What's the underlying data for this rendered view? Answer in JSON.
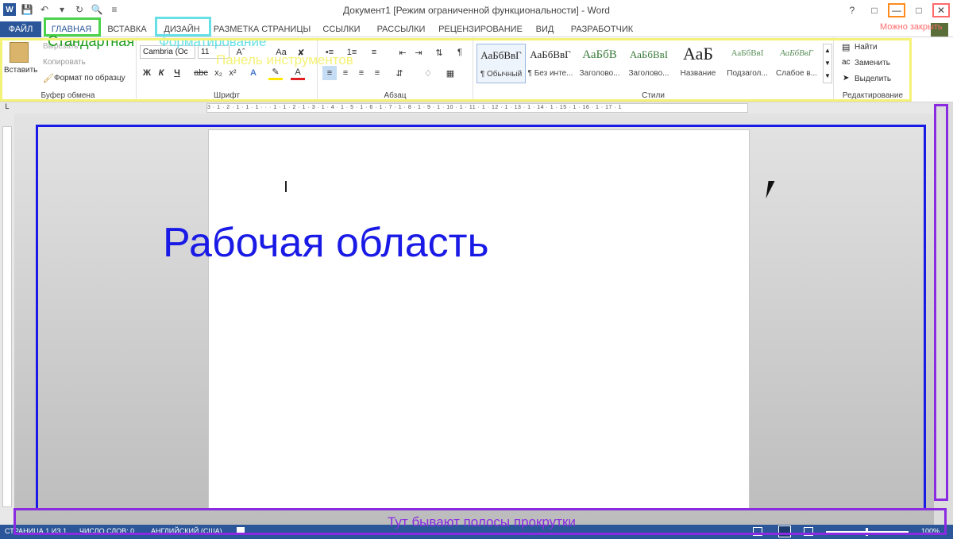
{
  "window": {
    "title": "Документ1 [Режим ограниченной функциональности] - Word",
    "word_icon": "W"
  },
  "tabs": [
    {
      "label": "ФАЙЛ"
    },
    {
      "label": "ГЛАВНАЯ"
    },
    {
      "label": "ВСТАВКА"
    },
    {
      "label": "ДИЗАЙН"
    },
    {
      "label": "РАЗМЕТКА СТРАНИЦЫ"
    },
    {
      "label": "ССЫЛКИ"
    },
    {
      "label": "РАССЫЛКИ"
    },
    {
      "label": "РЕЦЕНЗИРОВАНИЕ"
    },
    {
      "label": "ВИД"
    },
    {
      "label": "РАЗРАБОТЧИК"
    }
  ],
  "clipboard": {
    "paste": "Вставить",
    "cut": "Вырезать",
    "copy": "Копировать",
    "format_painter": "Формат по образцу",
    "group_label": "Буфер обмена"
  },
  "font": {
    "font_name": "Cambria (Ос",
    "font_size": "11",
    "change_case": "Aa",
    "bold": "Ж",
    "italic": "К",
    "underline": "Ч",
    "strike": "abc",
    "subscript": "x₂",
    "superscript": "x²",
    "group_label": "Шрифт"
  },
  "paragraph": {
    "sort": "¶",
    "group_label": "Абзац"
  },
  "styles": {
    "items": [
      {
        "preview": "АаБбВвГ",
        "name": "¶ Обычный"
      },
      {
        "preview": "АаБбВвГ",
        "name": "¶ Без инте..."
      },
      {
        "preview": "АаБбВ",
        "name": "Заголово..."
      },
      {
        "preview": "АаБбВвІ",
        "name": "Заголово..."
      },
      {
        "preview": "АаБ",
        "name": "Название"
      },
      {
        "preview": "АаБбВвІ",
        "name": "Подзагол..."
      },
      {
        "preview": "АаБбВвГ",
        "name": "Слабое в..."
      }
    ],
    "group_label": "Стили"
  },
  "editing": {
    "find": "Найти",
    "replace": "Заменить",
    "select": "Выделить",
    "group_label": "Редактирование"
  },
  "ruler": {
    "marks": "3 · 1 · 2 · 1 · 1 · 1 · · · 1 · 1 · 2 · 1 · 3 · 1 · 4 · 1 · 5 · 1 · 6 · 1 · 7 · 1 · 8 · 1 · 9 · 1 · 10 · 1 · 11 · 1 · 12 · 1 · 13 · 1 · 14 · 1 · 15 · 1 · 16 · 1 · 17 · 1"
  },
  "statusbar": {
    "page": "СТРАНИЦА 1 ИЗ 1",
    "words": "ЧИСЛО СЛОВ: 0",
    "language": "АНГЛИЙСКИЙ (США)",
    "zoom": "100%"
  },
  "annotations": {
    "standard": "Стандартная",
    "formatting": "Форматирование",
    "toolbar": "Панель инструментов",
    "workarea": "Рабочая область",
    "scrollbars": "Тут бывают полосы прокрутки",
    "close_hint": "Можно закрыть",
    "colors": {
      "green": "#4cd24c",
      "cyan": "#66e0e6",
      "yellow": "#f4f276",
      "blue": "#1a1ae6",
      "purple": "#8a2be2",
      "orange": "#ff8a1c",
      "red": "#ff6a6a"
    }
  }
}
